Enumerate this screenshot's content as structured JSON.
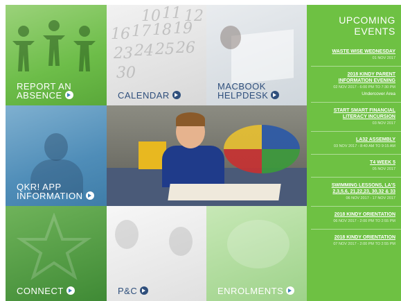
{
  "tiles": {
    "report": {
      "label_line1": "REPORT AN",
      "label_line2": "ABSENCE"
    },
    "calendar": {
      "label": "CALENDAR"
    },
    "macbook": {
      "label_line1": "MACBOOK",
      "label_line2": "HELPDESK"
    },
    "qkr": {
      "label_line1": "QKR! APP",
      "label_line2": "INFORMATION"
    },
    "connect": {
      "label": "CONNECT"
    },
    "pc": {
      "label": "P&C"
    },
    "enrolments": {
      "label": "ENROLMENTS"
    }
  },
  "calendar_numbers": [
    "10",
    "11",
    "12",
    "16",
    "17",
    "18",
    "19",
    "23",
    "24",
    "25",
    "26",
    "30"
  ],
  "sidebar": {
    "heading_line1": "UPCOMING",
    "heading_line2": "EVENTS",
    "events": [
      {
        "title": "WASTE WISE WEDNESDAY",
        "date": "01 NOV 2017",
        "location": ""
      },
      {
        "title": "2018 KINDY PARENT INFORMATION EVENING",
        "date": "02 NOV 2017 - 6:00 PM TO 7:30 PM",
        "location": "Undercover Area"
      },
      {
        "title": "START SMART FINANCIAL LITERACY INCURSION",
        "date": "03 NOV 2017",
        "location": ""
      },
      {
        "title": "LA32 ASSEMBLY",
        "date": "03 NOV 2017 - 8:40 AM TO 9:15 AM",
        "location": ""
      },
      {
        "title": "T4 WEEK 5",
        "date": "05 NOV 2017",
        "location": ""
      },
      {
        "title": "SWIMMING LESSONS, LA'S 2,3,5,6, 21,22,23, 30,32 & 33",
        "date": "06 NOV 2017 - 17 NOV 2017",
        "location": ""
      },
      {
        "title": "2018 KINDY ORIENTATION",
        "date": "06 NOV 2017 - 2:00 PM TO 2:55 PM",
        "location": ""
      },
      {
        "title": "2018 KINDY ORIENTATION",
        "date": "07 NOV 2017 - 2:00 PM TO 2:55 PM",
        "location": ""
      }
    ]
  },
  "colors": {
    "sidebar_green": "#6ec143",
    "tile_green": "#6dbd49",
    "tile_blue": "#4f8db8",
    "label_dark_blue": "#2f4f7c"
  },
  "icons": {
    "arrow": "arrow-circle-right-icon"
  }
}
